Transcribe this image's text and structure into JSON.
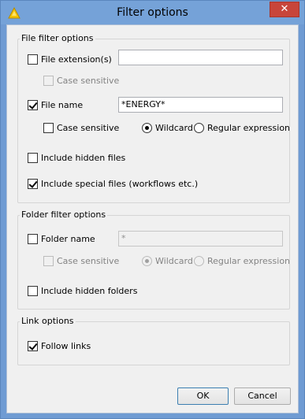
{
  "window": {
    "title": "Filter options",
    "icon": "warning-triangle-app-icon",
    "close_glyph": "✕"
  },
  "file_filter": {
    "group_label": "File filter options",
    "file_extension": {
      "label": "File extension(s)",
      "checked": false,
      "value": ""
    },
    "ext_case_sensitive": {
      "label": "Case sensitive",
      "checked": false,
      "enabled": false
    },
    "file_name": {
      "label": "File name",
      "checked": true,
      "value": "*ENERGY*"
    },
    "name_case_sensitive": {
      "label": "Case sensitive",
      "checked": false
    },
    "wildcard": {
      "label": "Wildcard",
      "selected": true
    },
    "regex": {
      "label": "Regular expression",
      "selected": false
    },
    "include_hidden": {
      "label": "Include hidden files",
      "checked": false
    },
    "include_special": {
      "label": "Include special files (workflows etc.)",
      "checked": true
    }
  },
  "folder_filter": {
    "group_label": "Folder filter options",
    "folder_name": {
      "label": "Folder name",
      "checked": false,
      "value": "*"
    },
    "case_sensitive": {
      "label": "Case sensitive",
      "checked": false,
      "enabled": false
    },
    "wildcard": {
      "label": "Wildcard",
      "selected": true,
      "enabled": false
    },
    "regex": {
      "label": "Regular expression",
      "selected": false,
      "enabled": false
    },
    "include_hidden": {
      "label": "Include hidden folders",
      "checked": false
    }
  },
  "link_options": {
    "group_label": "Link options",
    "follow_links": {
      "label": "Follow links",
      "checked": true
    }
  },
  "buttons": {
    "ok": "OK",
    "cancel": "Cancel"
  }
}
